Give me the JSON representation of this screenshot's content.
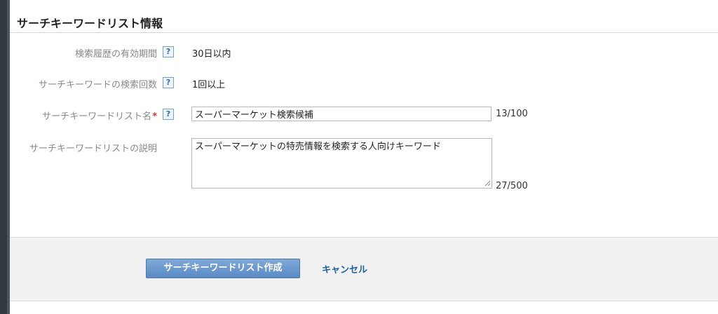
{
  "section": {
    "title": "サーチキーワードリスト情報"
  },
  "help_icon_glyph": "?",
  "fields": {
    "history_period": {
      "label": "検索履歴の有効期間",
      "value": "30日以内"
    },
    "search_count": {
      "label": "サーチキーワードの検索回数",
      "value": "1回以上"
    },
    "list_name": {
      "label": "サーチキーワードリスト名",
      "required_mark": "*",
      "value": "スーパーマーケット検索候補",
      "counter": "13/100"
    },
    "description": {
      "label": "サーチキーワードリストの説明",
      "value": "スーパーマーケットの特売情報を検索する人向けキーワード",
      "counter": "27/500"
    }
  },
  "actions": {
    "create_label": "サーチキーワードリスト作成",
    "cancel_label": "キャンセル"
  },
  "colors": {
    "primary_button": "#5a8ac4",
    "link": "#1f5f9e",
    "required": "#d9342b",
    "footer_band": "#f1f1f1"
  }
}
